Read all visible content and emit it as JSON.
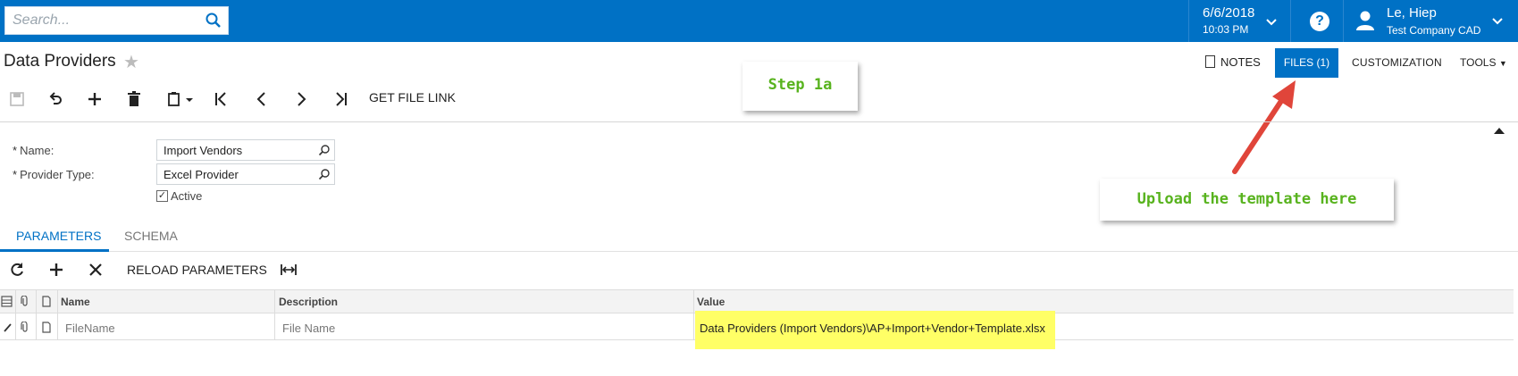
{
  "header": {
    "search_placeholder": "Search...",
    "date": "6/6/2018",
    "time": "10:03 PM",
    "user_name": "Le, Hiep",
    "company": "Test Company CAD",
    "brand_color": "#0071c5"
  },
  "page": {
    "title": "Data Providers",
    "actions": {
      "notes": "NOTES",
      "files": "FILES (1)",
      "customization": "CUSTOMIZATION",
      "tools": "TOOLS"
    }
  },
  "toolbar": {
    "icons": [
      "save-icon",
      "undo-icon",
      "add-icon",
      "delete-icon",
      "copy-paste-icon",
      "first-record-icon",
      "previous-record-icon",
      "next-record-icon",
      "last-record-icon"
    ],
    "get_file_link": "GET FILE LINK"
  },
  "annotations": {
    "step": "Step 1a",
    "upload_hint": "Upload the template here"
  },
  "form": {
    "name_label": "Name:",
    "name_value": "Import Vendors",
    "provider_type_label": "Provider Type:",
    "provider_type_value": "Excel Provider",
    "active_label": "Active",
    "active_checked": true
  },
  "tabs": [
    {
      "label": "PARAMETERS",
      "active": true
    },
    {
      "label": "SCHEMA",
      "active": false
    }
  ],
  "grid_toolbar": {
    "reload": "RELOAD PARAMETERS"
  },
  "grid": {
    "columns": [
      "Name",
      "Description",
      "Value"
    ],
    "rows": [
      {
        "name": "FileName",
        "description": "File Name",
        "value": "Data Providers (Import Vendors)\\AP+Import+Vendor+Template.xlsx"
      }
    ]
  }
}
